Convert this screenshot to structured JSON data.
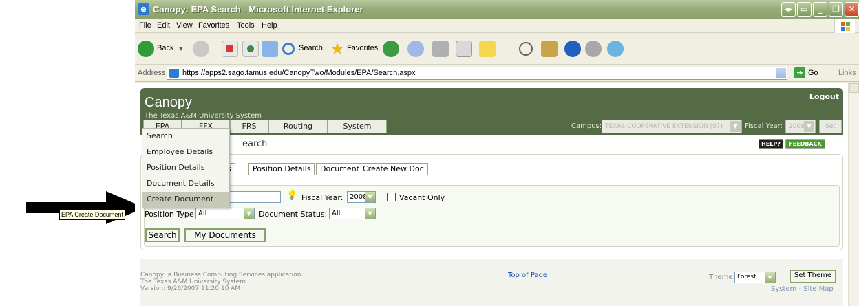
{
  "window": {
    "title": "Canopy: EPA Search - Microsoft Internet Explorer"
  },
  "menu": [
    "File",
    "Edit",
    "View",
    "Favorites",
    "Tools",
    "Help"
  ],
  "toolbar": {
    "back_label": "Back",
    "search_label": "Search",
    "favorites_label": "Favorites"
  },
  "address": {
    "label": "Address",
    "url": "https://apps2.sago.tamus.edu/CanopyTwo/Modules/EPA/Search.aspx",
    "go_label": "Go",
    "links_label": "Links"
  },
  "app": {
    "brand": "Canopy",
    "subtitle": "The Texas A&M University System",
    "logout": "Logout",
    "nav_tabs": [
      "EPA",
      "FFX",
      "FRS",
      "Routing",
      "System"
    ],
    "campus_label": "Campus:",
    "campus_value": "TEXAS COOPERATIVE EXTENSION (07)",
    "fy_label": "Fiscal Year:",
    "fy_value": "2008",
    "set_button": "Set CC/FY",
    "page_title": "earch",
    "help_badge": "HELP?",
    "feedback_badge": "FEEDBACK"
  },
  "dropdown": {
    "items": [
      "Search",
      "Employee Details",
      "Position Details",
      "Document Details",
      "Create Document"
    ],
    "highlighted_index": 4
  },
  "tooltip": "EPA Create Document",
  "subtabs": [
    "tails",
    "Position Details",
    "Document",
    "Create New Doc"
  ],
  "form": {
    "fiscal_year_label": "Fiscal Year:",
    "fiscal_year_value": "2008",
    "vacant_only_label": "Vacant Only",
    "position_type_label": "Position Type:",
    "position_type_value": "All",
    "document_status_label": "Document Status:",
    "document_status_value": "All",
    "search_button": "Search",
    "my_documents_button": "My Documents"
  },
  "footer": {
    "line1": "Canopy, a Business Computing Services application.",
    "line2": "The Texas A&M University System",
    "line3": "Version: 9/26/2007 11:20:10 AM",
    "top_of_page": "Top of Page",
    "theme_label": "Theme:",
    "theme_value": "Forest",
    "set_theme_button": "Set Theme",
    "site_map": "System - Site Map"
  },
  "colors": {
    "header_green": "#556b45",
    "title_bar_green": "#98ad79",
    "dropdown_highlight": "#c7c9b7",
    "link_blue": "#1d4fa8"
  }
}
